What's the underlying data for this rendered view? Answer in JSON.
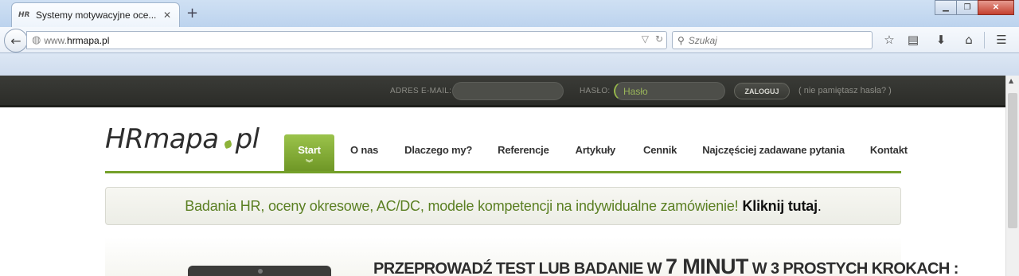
{
  "browser": {
    "tab_favicon": "HR",
    "tab_title": "Systemy motywacyjne oce...",
    "tab_close": "✕",
    "new_tab": "+",
    "window_buttons": [
      "minimize",
      "maximize",
      "close"
    ],
    "url_prefix": "www.",
    "url_host": "hrmapa.pl",
    "search_placeholder": "Szukaj",
    "toolbar_icons": [
      "star-icon",
      "reading-list-icon",
      "download-icon",
      "home-icon",
      "menu-icon"
    ]
  },
  "loginbar": {
    "email_label": "ADRES E-MAIL:",
    "password_label": "HASŁO:",
    "password_placeholder": "Hasło",
    "login_button": "ZALOGUJ",
    "forgot_text": "( nie pamiętasz hasła? )"
  },
  "site": {
    "logo_left": "HRmapa",
    "logo_right": "pl",
    "menu": [
      {
        "label": "Start",
        "active": true
      },
      {
        "label": "O nas"
      },
      {
        "label": "Dlaczego my?"
      },
      {
        "label": "Referencje"
      },
      {
        "label": "Artykuły"
      },
      {
        "label": "Cennik"
      },
      {
        "label": "Najczęściej zadawane pytania"
      },
      {
        "label": "Kontakt"
      }
    ],
    "banner": {
      "text": "Badania HR, oceny okresowe, AC/DC, modele kompetencji na indywidualne zamówienie!",
      "link": "Kliknij tutaj",
      "end": "."
    },
    "headline": {
      "part1": "PRZEPROWADŹ TEST LUB BADANIE W ",
      "big": "7 MINUT",
      "part2": " W 3 PROSTYCH KROKACH :"
    }
  },
  "colors": {
    "accent_green": "#74a029",
    "banner_text": "#5a7f22",
    "login_bar": "#2f302c"
  }
}
